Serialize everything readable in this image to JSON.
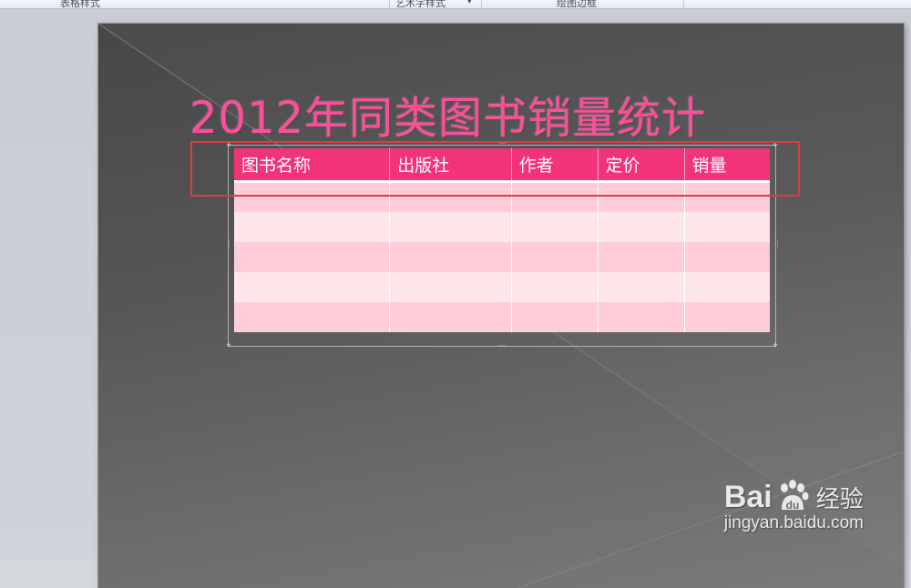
{
  "ribbon": {
    "groups": [
      "表格样式",
      "艺术字样式",
      "绘图边框"
    ]
  },
  "slide": {
    "title": "2012年同类图书销量统计",
    "title_color": "#ff4d9a"
  },
  "table": {
    "headers": [
      "图书名称",
      "出版社",
      "作者",
      "定价",
      "销量"
    ],
    "header_color": "#f2337a",
    "row_colors": [
      "#ffcdd8",
      "#ffe6ea"
    ],
    "rows": [
      [
        "",
        "",
        "",
        "",
        ""
      ],
      [
        "",
        "",
        "",
        "",
        ""
      ],
      [
        "",
        "",
        "",
        "",
        ""
      ],
      [
        "",
        "",
        "",
        "",
        ""
      ],
      [
        "",
        "",
        "",
        "",
        ""
      ]
    ]
  },
  "annotation": {
    "color": "#e03c3c"
  },
  "watermark": {
    "brand": "Bai",
    "brand_suffix": "经验",
    "url": "jingyan.baidu.com"
  }
}
